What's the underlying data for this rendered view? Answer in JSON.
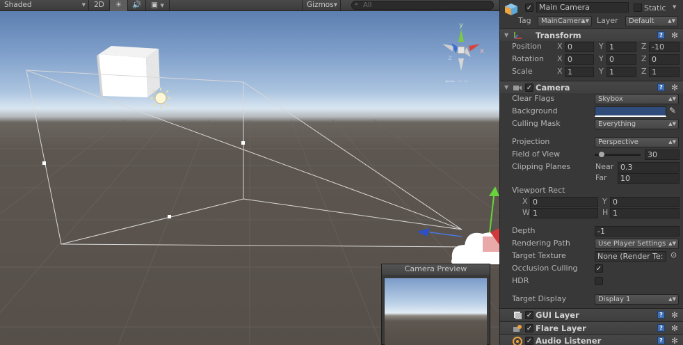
{
  "scene_toolbar": {
    "shading_mode": "Shaded",
    "mode_2d": "2D",
    "lighting_glyph": "☀",
    "audio_glyph": "🔊",
    "effects_glyph": "▣",
    "gizmos_label": "Gizmos",
    "search_placeholder": "All"
  },
  "scene": {
    "gizmo_labels": {
      "y": "y",
      "x": "x",
      "z": "z"
    },
    "camera_preview_title": "Camera Preview"
  },
  "inspector": {
    "object_name": "Main Camera",
    "static_label": "Static",
    "tag_label": "Tag",
    "tag_value": "MainCamera",
    "layer_label": "Layer",
    "layer_value": "Default",
    "transform": {
      "title": "Transform",
      "position_label": "Position",
      "rotation_label": "Rotation",
      "scale_label": "Scale",
      "axis_x": "X",
      "axis_y": "Y",
      "axis_z": "Z",
      "position": {
        "x": "0",
        "y": "1",
        "z": "-10"
      },
      "rotation": {
        "x": "0",
        "y": "0",
        "z": "0"
      },
      "scale": {
        "x": "1",
        "y": "1",
        "z": "1"
      }
    },
    "camera": {
      "title": "Camera",
      "clear_flags_label": "Clear Flags",
      "clear_flags": "Skybox",
      "background_label": "Background",
      "background_color": "#2f4c7a",
      "culling_mask_label": "Culling Mask",
      "culling_mask": "Everything",
      "projection_label": "Projection",
      "projection": "Perspective",
      "fov_label": "Field of View",
      "fov_value": "30",
      "fov_fraction": 0.15,
      "clipping_label": "Clipping Planes",
      "near_label": "Near",
      "near_value": "0.3",
      "far_label": "Far",
      "far_value": "10",
      "viewport_label": "Viewport Rect",
      "vp_x_label": "X",
      "vp_x": "0",
      "vp_y_label": "Y",
      "vp_y": "0",
      "vp_w_label": "W",
      "vp_w": "1",
      "vp_h_label": "H",
      "vp_h": "1",
      "depth_label": "Depth",
      "depth_value": "-1",
      "rendering_path_label": "Rendering Path",
      "rendering_path": "Use Player Settings",
      "target_texture_label": "Target Texture",
      "target_texture": "None (Render Te:",
      "occlusion_label": "Occlusion Culling",
      "occlusion_checked": "✓",
      "hdr_label": "HDR",
      "target_display_label": "Target Display",
      "target_display": "Display 1"
    },
    "gui_layer_title": "GUI Layer",
    "flare_layer_title": "Flare Layer",
    "audio_listener_title": "Audio Listener",
    "check_glyph": "✓",
    "help_glyph": "?",
    "gear_glyph": "✻",
    "updown_glyph": "▲▼"
  }
}
